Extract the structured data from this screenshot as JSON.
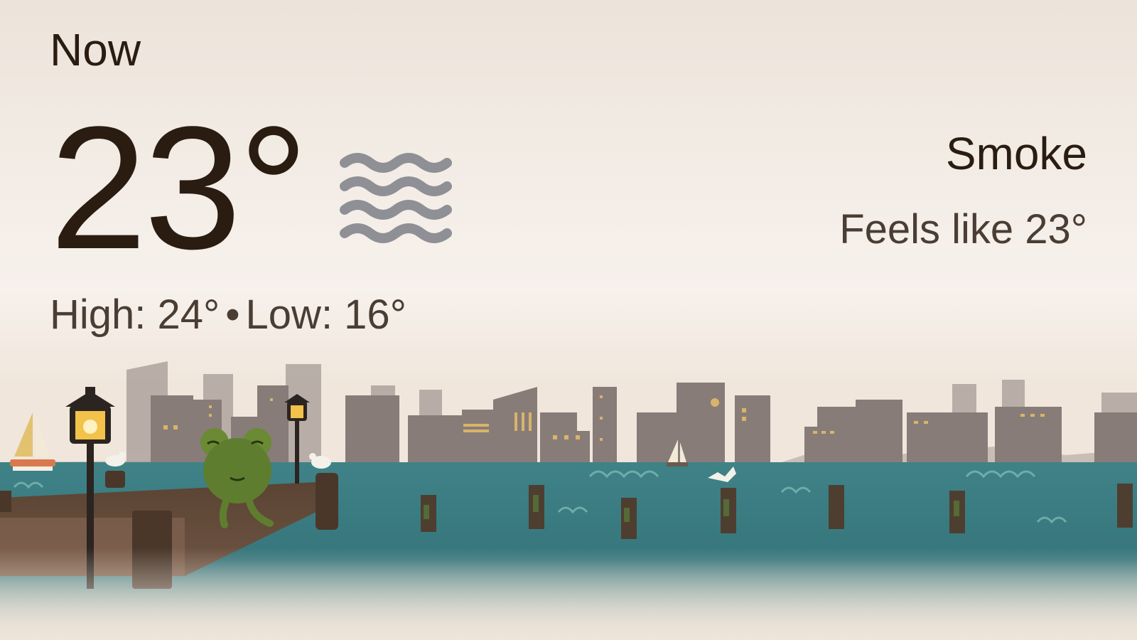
{
  "header": {
    "title": "Now"
  },
  "current": {
    "temperature": "23°",
    "condition": "Smoke",
    "condition_icon": "smoke-haze-icon",
    "feels_like": "Feels like 23°",
    "high": "High: 24°",
    "separator": "•",
    "low": "Low: 16°"
  },
  "colors": {
    "text_primary": "#2a1c10",
    "text_secondary": "#4a3d33",
    "icon": "#8f9096",
    "water": "#3b7f84",
    "frog": "#5f7d2e"
  }
}
